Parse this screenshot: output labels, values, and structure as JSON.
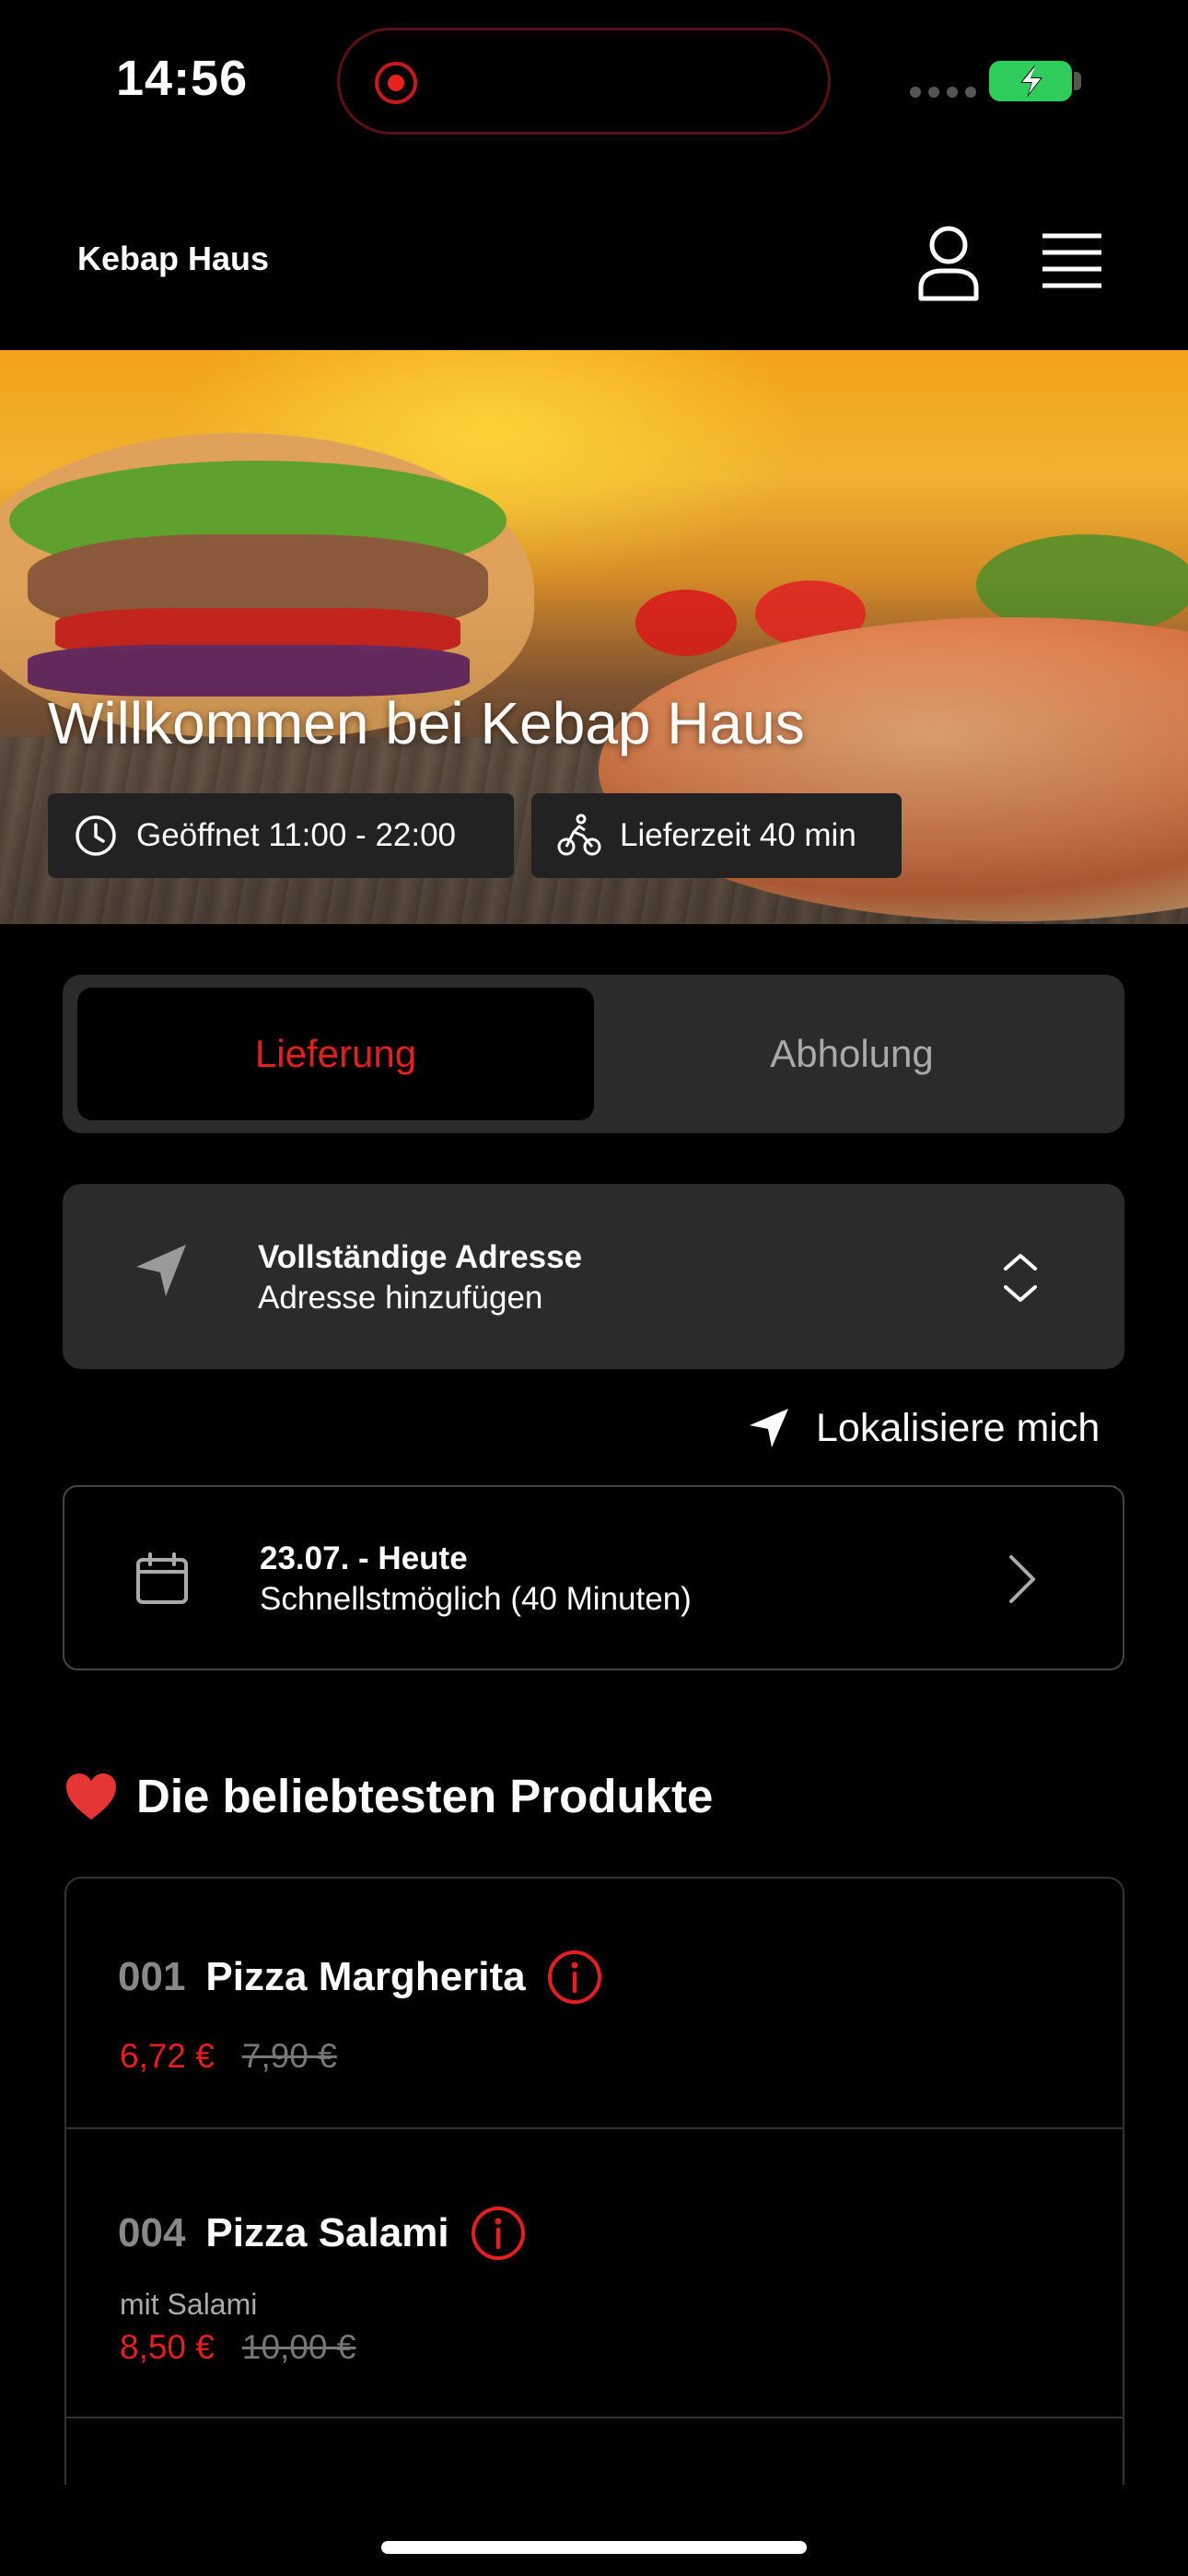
{
  "status_bar": {
    "time": "14:56"
  },
  "header": {
    "title": "Kebap Haus"
  },
  "hero": {
    "title": "Willkommen bei Kebap Haus",
    "open_hours": "Geöffnet 11:00 - 22:00",
    "delivery_time": "Lieferzeit 40 min"
  },
  "mode_toggle": {
    "active": "Lieferung",
    "inactive": "Abholung"
  },
  "address": {
    "title": "Vollständige Adresse",
    "subtitle": "Adresse hinzufügen"
  },
  "locate": {
    "label": "Lokalisiere mich"
  },
  "schedule": {
    "date": "23.07. - Heute",
    "subtitle": "Schnellstmöglich (40 Minuten)"
  },
  "popular": {
    "title": "Die beliebtesten Produkte",
    "products": [
      {
        "number": "001",
        "name": "Pizza Margherita",
        "description": "",
        "price": "6,72 €",
        "old_price": "7,90 €"
      },
      {
        "number": "004",
        "name": "Pizza Salami",
        "description": "mit Salami",
        "price": "8,50 €",
        "old_price": "10,00 €"
      }
    ]
  },
  "colors": {
    "accent": "#e3201f",
    "card": "#2b2b2b",
    "background": "#000000"
  }
}
